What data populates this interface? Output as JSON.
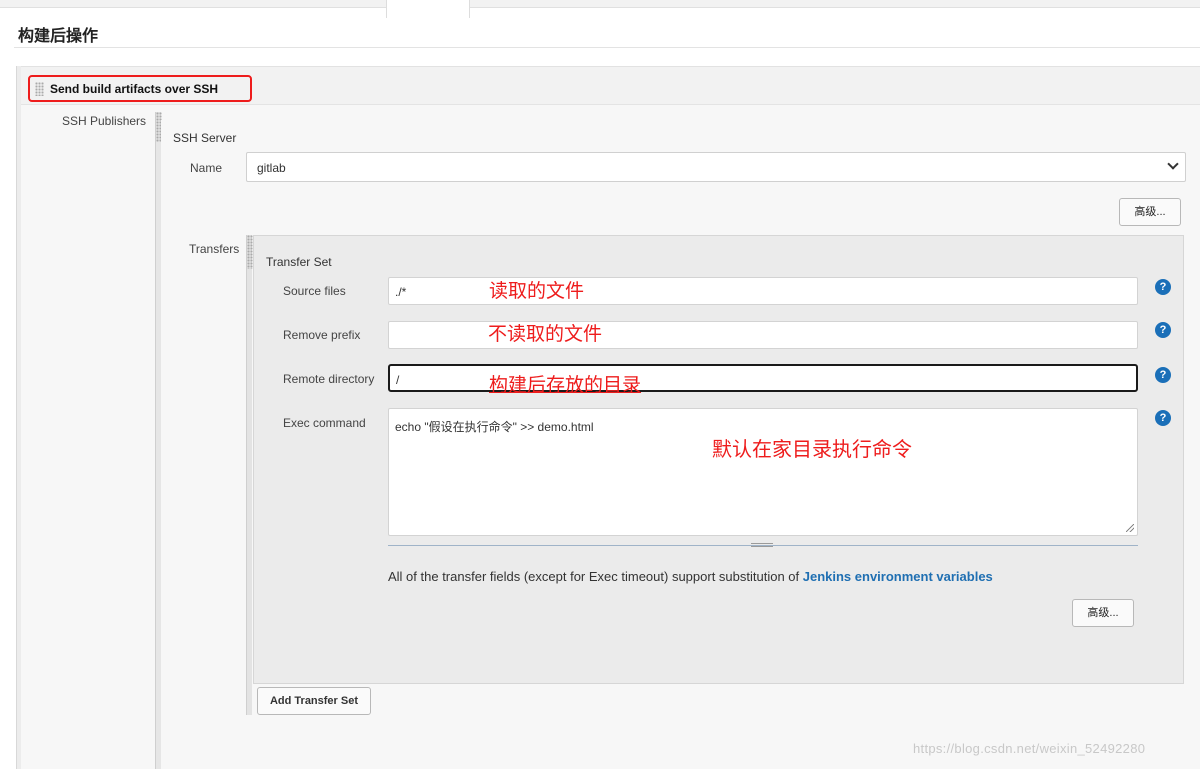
{
  "page": {
    "section_title": "构建后操作",
    "step_name": "Send build artifacts over SSH"
  },
  "publishers": {
    "label": "SSH Publishers",
    "server_title": "SSH Server",
    "name_label": "Name",
    "name_value": "gitlab",
    "advanced_label": "高级..."
  },
  "transfers": {
    "label": "Transfers",
    "set_title": "Transfer Set",
    "fields": {
      "source_files": {
        "label": "Source files",
        "value": "./*"
      },
      "remove_prefix": {
        "label": "Remove prefix",
        "value": ""
      },
      "remote_directory": {
        "label": "Remote directory",
        "value": "/"
      },
      "exec_command": {
        "label": "Exec command",
        "value": "echo \"假设在执行命令\" >> demo.html"
      }
    },
    "help_glyph": "?",
    "info_text": "All of the transfer fields (except for Exec timeout) support substitution of ",
    "info_link": "Jenkins environment variables",
    "advanced_label": "高级...",
    "add_button": "Add Transfer Set"
  },
  "annotations": {
    "source_note": "读取的文件",
    "prefix_note": "不读取的文件",
    "remote_note": "构建后存放的目录",
    "exec_note": "默认在家目录执行命令"
  },
  "watermark": "https://blog.csdn.net/weixin_52492280",
  "colors": {
    "annotation_red": "#ee1c1c",
    "help_blue": "#1a6fb8",
    "link_blue": "#1f6fb2"
  },
  "icons": {
    "help": "help-circle-icon",
    "dropdown": "chevron-down-icon",
    "drag": "drag-handle-icon"
  }
}
